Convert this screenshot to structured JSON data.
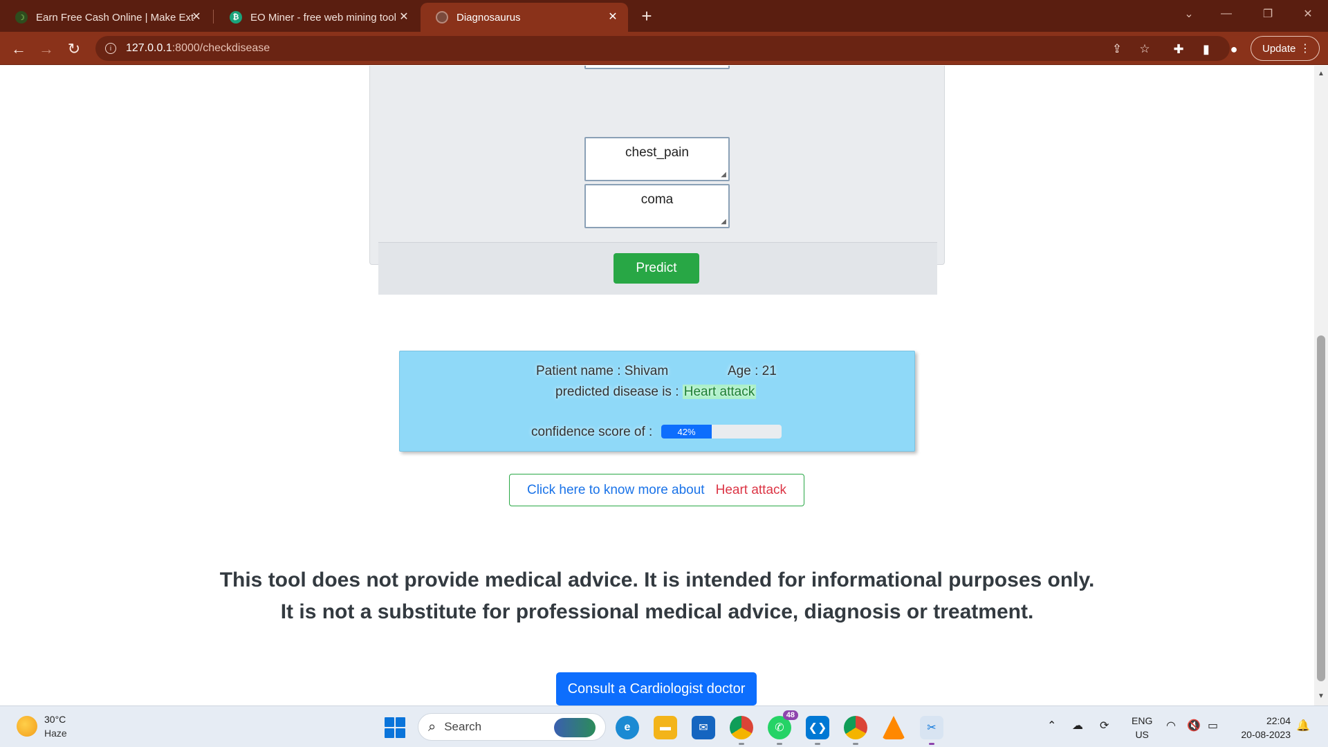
{
  "browser": {
    "tabs": [
      {
        "title": "Earn Free Cash Online | Make Ext",
        "active": false
      },
      {
        "title": "EO Miner - free web mining tool",
        "active": false
      },
      {
        "title": "Diagnosaurus",
        "active": true
      }
    ],
    "new_tab_symbol": "+",
    "url_host": "127.0.0.1",
    "url_path": ":8000/checkdisease",
    "update_label": "Update"
  },
  "form": {
    "symptoms": [
      "chest_pain",
      "coma"
    ],
    "predict_label": "Predict"
  },
  "result": {
    "patient_label": "Patient name : Shivam",
    "age_label": "Age : 21",
    "predicted_prefix": "predicted disease is : ",
    "predicted_disease": "Heart attack",
    "confidence_label": "confidence score of :",
    "confidence_percent": 42,
    "confidence_text": "42%"
  },
  "know_more": {
    "text": "Click here to know more about",
    "disease": "Heart attack"
  },
  "disclaimer": {
    "line1": "This tool does not provide medical advice. It is intended for informational purposes only.",
    "line2": "It is not a substitute for professional medical advice, diagnosis or treatment."
  },
  "consult": {
    "label": "Consult a Cardiologist doctor"
  },
  "taskbar": {
    "weather_temp": "30°C",
    "weather_desc": "Haze",
    "search_placeholder": "Search",
    "whatsapp_badge": "48",
    "lang_top": "ENG",
    "lang_bottom": "US",
    "time": "22:04",
    "date": "20-08-2023"
  },
  "colors": {
    "tab_strip": "#5a1e10",
    "toolbar": "#8a321a",
    "result_card": "#8fd9f8",
    "predict_button": "#28a745",
    "consult_button": "#0d6efd",
    "progress_fill": "#0d6efd"
  }
}
